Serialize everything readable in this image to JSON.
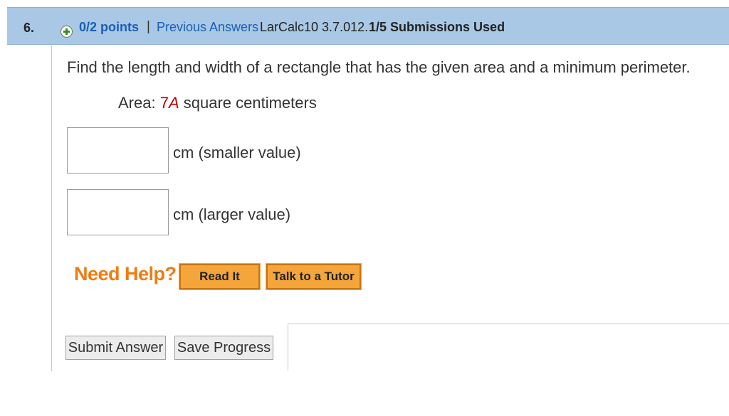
{
  "header": {
    "question_number": "6.",
    "points": "0/2 points",
    "separator": "|",
    "previous_answers": "Previous Answers",
    "course_ref": "LarCalc10 3.7.012.",
    "submissions": "1/5 Submissions Used"
  },
  "question": {
    "text": "Find the length and width of a rectangle that has the given area and a minimum perimeter.",
    "area_label": "Area: ",
    "area_value": "7",
    "area_var": "A",
    "area_unit": " square centimeters"
  },
  "answers": [
    {
      "value": "",
      "unit": "cm (smaller value)"
    },
    {
      "value": "",
      "unit": "cm (larger value)"
    }
  ],
  "help": {
    "label": "Need Help?",
    "read_it": "Read It",
    "talk_tutor": "Talk to a Tutor"
  },
  "actions": {
    "submit": "Submit Answer",
    "save": "Save Progress"
  },
  "colors": {
    "header_bg": "#a9c8e6",
    "link": "#1a5fb4",
    "need_help": "#f07c11",
    "help_button": "#f4a63a",
    "highlight_red": "#c00000"
  }
}
